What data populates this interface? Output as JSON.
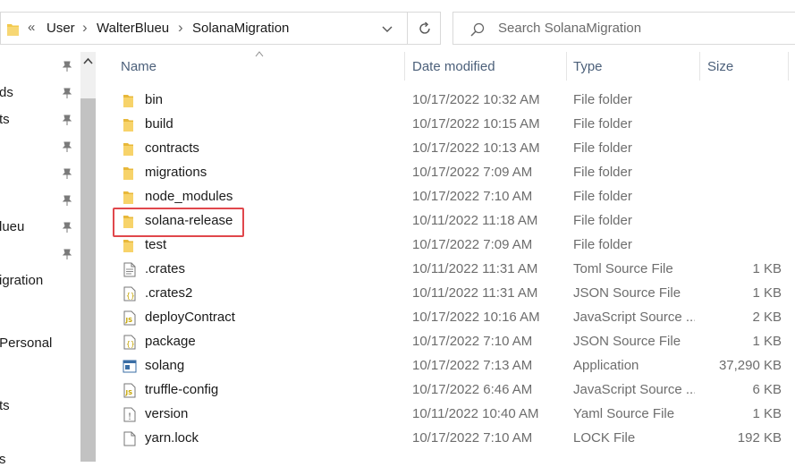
{
  "address": {
    "overflow_glyph": "«",
    "crumbs": [
      "User",
      "WalterBlueu",
      "SolanaMigration"
    ],
    "separator": "›"
  },
  "search": {
    "placeholder": "Search SolanaMigration"
  },
  "nav": {
    "items": [
      {
        "label": "ds"
      },
      {
        "label": "ts"
      },
      {
        "label": "lueu"
      },
      {
        "label": "igration"
      },
      {
        "label": "- Personal"
      },
      {
        "label": "ts"
      },
      {
        "label": "s"
      }
    ]
  },
  "columns": {
    "name": "Name",
    "date": "Date modified",
    "type": "Type",
    "size": "Size"
  },
  "colors": {
    "folder": "#f2c94c",
    "highlight_border": "#e0474c",
    "header_text": "#4c607a"
  },
  "files": [
    {
      "name": "bin",
      "date": "10/17/2022 10:32 AM",
      "type": "File folder",
      "size": "",
      "icon": "folder-icon"
    },
    {
      "name": "build",
      "date": "10/17/2022 10:15 AM",
      "type": "File folder",
      "size": "",
      "icon": "folder-icon"
    },
    {
      "name": "contracts",
      "date": "10/17/2022 10:13 AM",
      "type": "File folder",
      "size": "",
      "icon": "folder-icon"
    },
    {
      "name": "migrations",
      "date": "10/17/2022 7:09 AM",
      "type": "File folder",
      "size": "",
      "icon": "folder-icon"
    },
    {
      "name": "node_modules",
      "date": "10/17/2022 7:10 AM",
      "type": "File folder",
      "size": "",
      "icon": "folder-icon"
    },
    {
      "name": "solana-release",
      "date": "10/11/2022 11:18 AM",
      "type": "File folder",
      "size": "",
      "icon": "folder-icon"
    },
    {
      "name": "test",
      "date": "10/17/2022 7:09 AM",
      "type": "File folder",
      "size": "",
      "icon": "folder-icon"
    },
    {
      "name": ".crates",
      "date": "10/11/2022 11:31 AM",
      "type": "Toml Source File",
      "size": "1 KB",
      "icon": "text-file-icon"
    },
    {
      "name": ".crates2",
      "date": "10/11/2022 11:31 AM",
      "type": "JSON Source File",
      "size": "1 KB",
      "icon": "json-file-icon"
    },
    {
      "name": "deployContract",
      "date": "10/17/2022 10:16 AM",
      "type": "JavaScript Source ...",
      "size": "2 KB",
      "icon": "js-file-icon"
    },
    {
      "name": "package",
      "date": "10/17/2022 7:10 AM",
      "type": "JSON Source File",
      "size": "1 KB",
      "icon": "json-file-icon"
    },
    {
      "name": "solang",
      "date": "10/17/2022 7:13 AM",
      "type": "Application",
      "size": "37,290 KB",
      "icon": "application-icon"
    },
    {
      "name": "truffle-config",
      "date": "10/17/2022 6:46 AM",
      "type": "JavaScript Source ...",
      "size": "6 KB",
      "icon": "js-file-icon"
    },
    {
      "name": "version",
      "date": "10/11/2022 10:40 AM",
      "type": "Yaml Source File",
      "size": "1 KB",
      "icon": "yaml-file-icon"
    },
    {
      "name": "yarn.lock",
      "date": "10/17/2022 7:10 AM",
      "type": "LOCK File",
      "size": "192 KB",
      "icon": "blank-file-icon"
    }
  ]
}
